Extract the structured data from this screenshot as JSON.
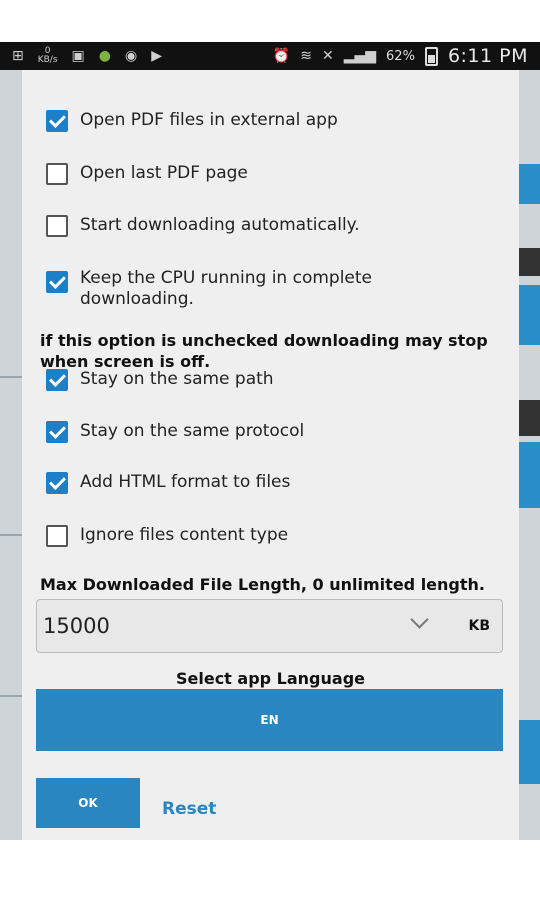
{
  "status_bar": {
    "left_icons": [
      "plus-icon",
      "download-speed-icon",
      "image-icon",
      "android-icon",
      "hangouts-icon",
      "youtube-icon"
    ],
    "speed_text": "0",
    "speed_unit": "KB/s",
    "right_icons": [
      "alarm-icon",
      "wifi-icon",
      "signal-icon"
    ],
    "battery_percent": "62%",
    "time": "6:11 PM"
  },
  "settings": {
    "options": [
      {
        "label": "Open PDF files in external app",
        "checked": true
      },
      {
        "label": "Open last PDF page",
        "checked": false
      },
      {
        "label": "Start downloading automatically.",
        "checked": false
      },
      {
        "label": "Keep the CPU running in complete downloading.",
        "checked": true
      },
      {
        "label": "Stay on the same path",
        "checked": true
      },
      {
        "label": "Stay on the same protocol",
        "checked": true
      },
      {
        "label": "Add HTML format to files",
        "checked": true
      },
      {
        "label": "Ignore files content type",
        "checked": false
      }
    ],
    "cpu_note": "if this option is unchecked downloading may stop when screen is off.",
    "max_length_label": "Max Downloaded File Length, 0 unlimited length.",
    "max_length_value": "15000",
    "max_length_unit": "KB",
    "language_label": "Select app Language",
    "language_value": "EN",
    "ok_label": "OK",
    "reset_label": "Reset"
  },
  "colors": {
    "accent": "#2a86c0",
    "checkbox_checked": "#1e7fc9",
    "dialog_bg": "#efefef"
  }
}
